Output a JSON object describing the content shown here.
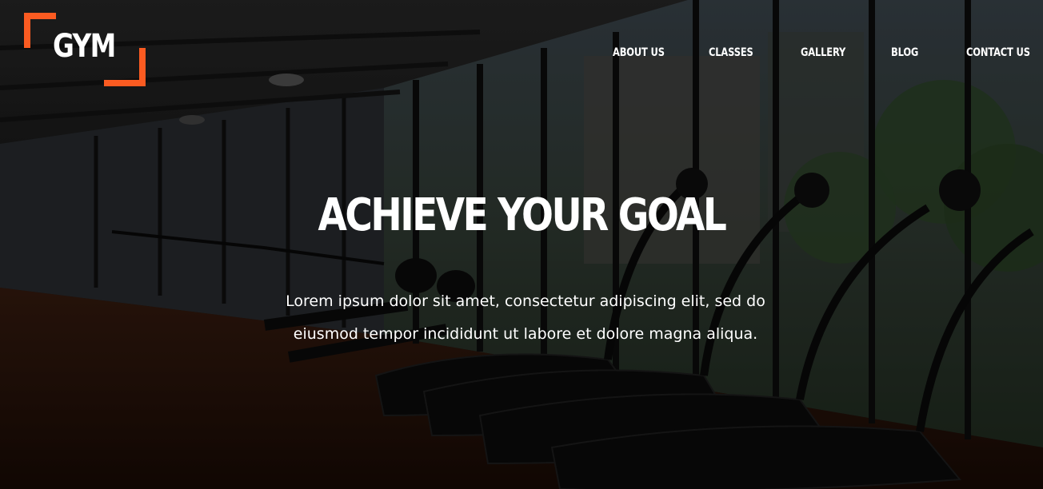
{
  "logo": {
    "text": "GYM",
    "accent_color": "#fb5b21"
  },
  "nav": {
    "items": [
      {
        "label": "ABOUT US"
      },
      {
        "label": "CLASSES"
      },
      {
        "label": "GALLERY"
      },
      {
        "label": "BLOG"
      },
      {
        "label": "CONTACT US"
      }
    ]
  },
  "hero": {
    "title": "ACHIEVE YOUR GOAL",
    "subtitle_line1": "Lorem ipsum dolor sit amet, consectetur adipiscing elit, sed do",
    "subtitle_line2": "eiusmod tempor incididunt ut labore et dolore magna aliqua.",
    "background": "gym-treadmills-photo"
  }
}
